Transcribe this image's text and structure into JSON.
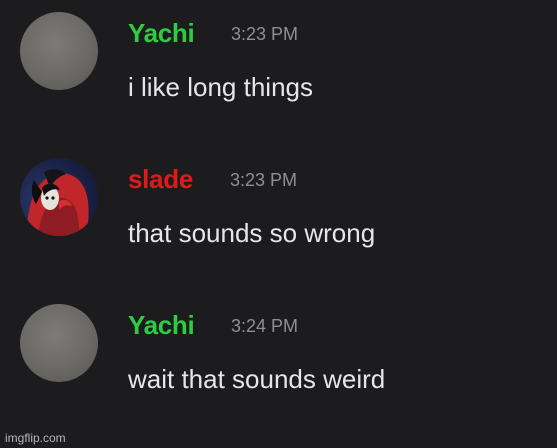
{
  "colors": {
    "background": "#1c1c1e",
    "username_green": "#2ecc40",
    "username_red": "#e0191a",
    "timestamp": "#8e8f93",
    "message_text": "#e6e6e8"
  },
  "messages": [
    {
      "username": "Yachi",
      "username_color": "#2ecc40",
      "timestamp": "3:23 PM",
      "text": "i like long things",
      "avatar": "gray-avatar"
    },
    {
      "username": "slade",
      "username_color": "#e0191a",
      "timestamp": "3:23 PM",
      "text": "that sounds so wrong",
      "avatar": "dark-haired-character-avatar"
    },
    {
      "username": "Yachi",
      "username_color": "#2ecc40",
      "timestamp": "3:24 PM",
      "text": "wait that sounds weird",
      "avatar": "gray-avatar"
    }
  ],
  "watermark": "imgflip.com"
}
